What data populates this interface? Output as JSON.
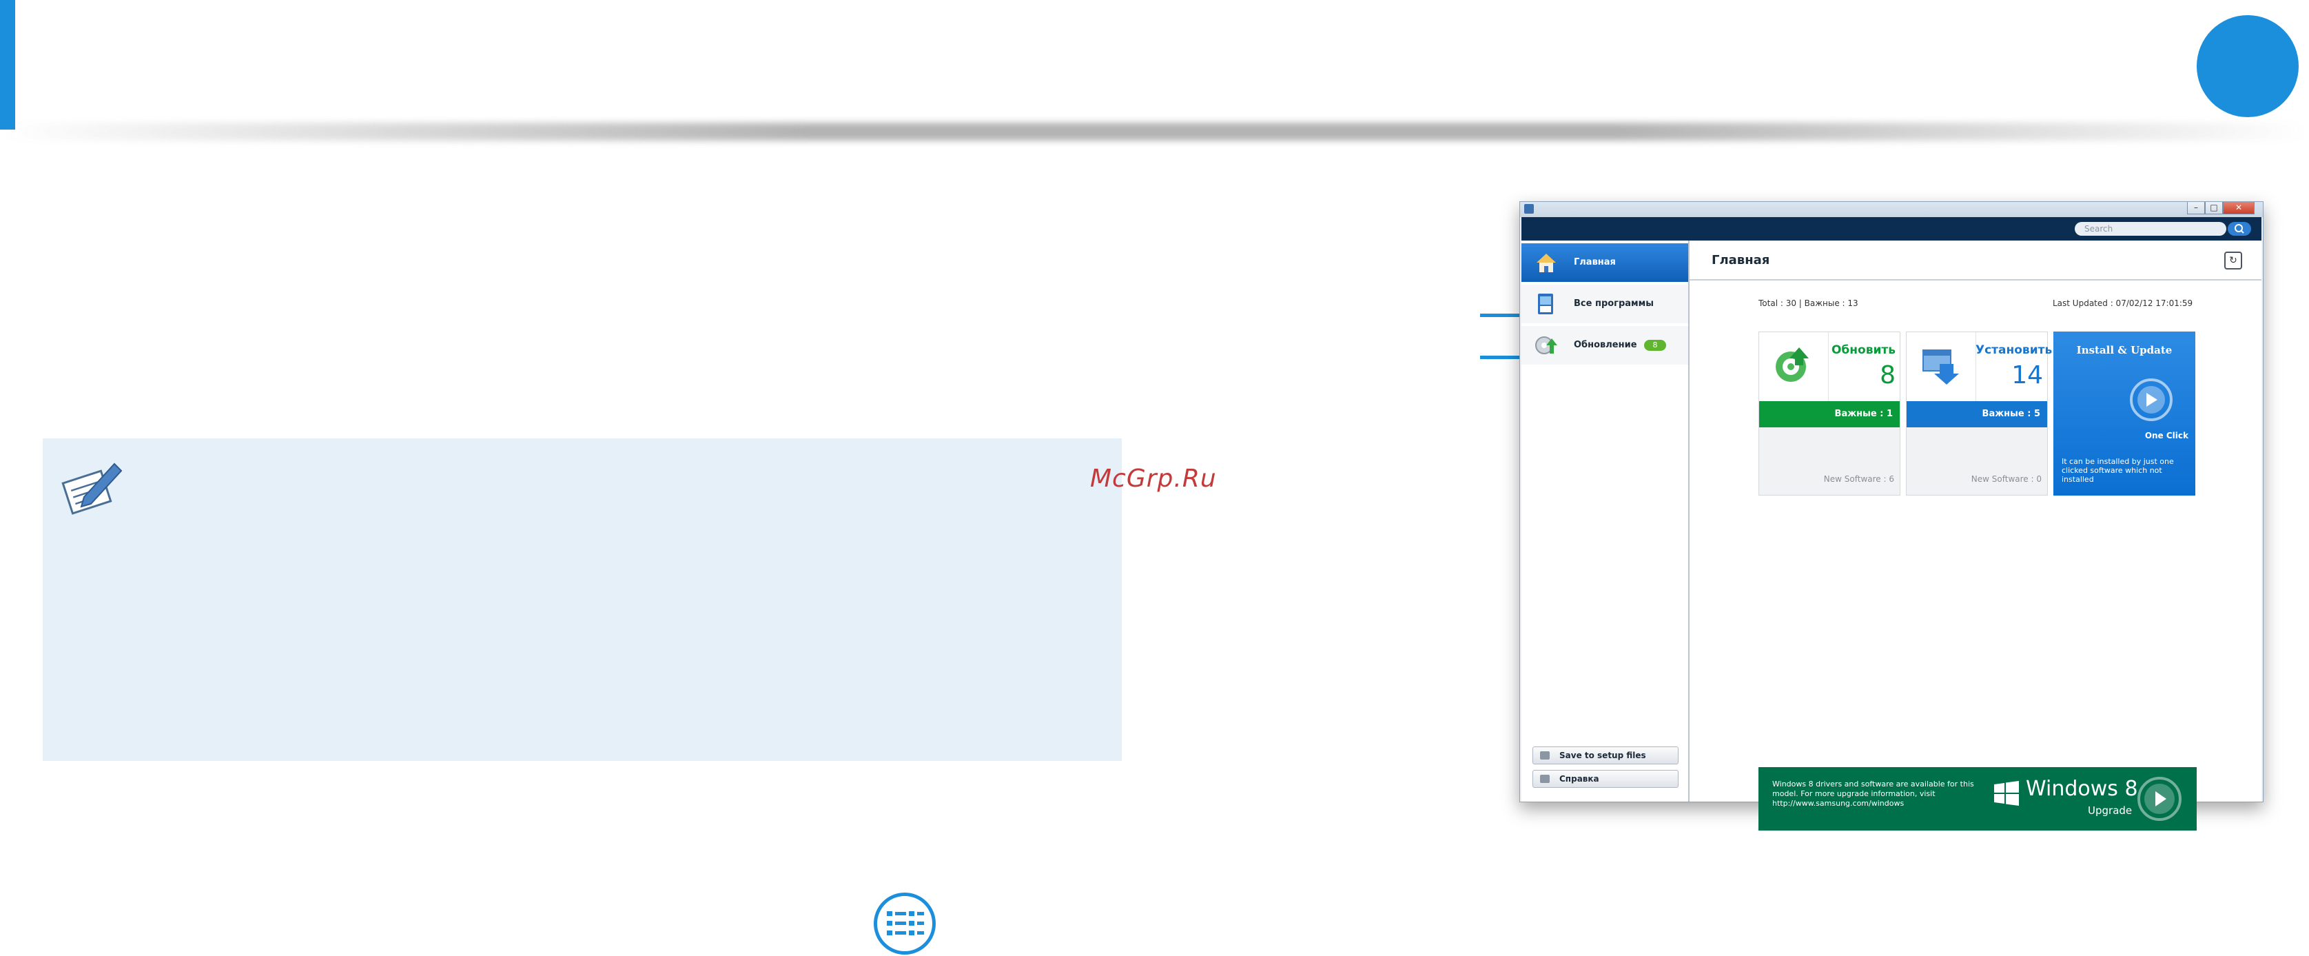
{
  "page": {
    "watermark": "McGrp.Ru"
  },
  "app": {
    "search_placeholder": "Search",
    "window_buttons": {
      "minimize": "–",
      "maximize": "□",
      "close": "✕"
    },
    "sidebar": {
      "items": [
        {
          "label": "Главная",
          "icon": "home-icon",
          "selected": true
        },
        {
          "label": "Все программы",
          "icon": "all-programs-icon",
          "selected": false
        },
        {
          "label": "Обновление",
          "icon": "update-icon",
          "selected": false,
          "badge": "8"
        }
      ],
      "buttons": [
        {
          "label": "Save to setup files",
          "icon": "save-icon"
        },
        {
          "label": "Справка",
          "icon": "help-icon"
        }
      ]
    },
    "main": {
      "title": "Главная",
      "refresh_icon": "↻",
      "totals": "Total : 30 | Важные : 13",
      "last_updated": "Last Updated : 07/02/12 17:01:59",
      "cards": [
        {
          "title": "Обновить",
          "count": "8",
          "important": "Важные : 1",
          "footer": "New Software : 6",
          "color": "#0a9a3b",
          "icon": "update-disc-icon"
        },
        {
          "title": "Установить",
          "count": "14",
          "important": "Важные : 5",
          "footer": "New Software : 0",
          "color": "#1677d0",
          "icon": "install-download-icon"
        }
      ],
      "install_card": {
        "title": "Install & Update",
        "one_click": "One Click",
        "description": "It can be installed by just one clicked software which not installed",
        "color": "#0b6fd2"
      },
      "win8_banner": {
        "text": "Windows 8 drivers and software are available for this model. For more upgrade information, visit http://www.samsung.com/windows",
        "product": "Windows 8",
        "action": "Upgrade",
        "color": "#00704a"
      }
    }
  },
  "colors": {
    "accent": "#1b8fdc",
    "note_bg": "#e6f0f9",
    "topbar": "#0c2d52"
  }
}
